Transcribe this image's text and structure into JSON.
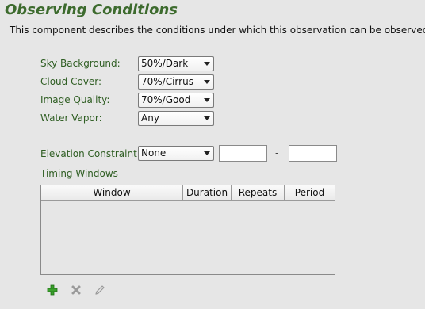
{
  "title": "Observing Conditions",
  "description": "This component describes the conditions under which this observation can be observed.",
  "conditions": {
    "sky_background": {
      "label": "Sky Background:",
      "value": "50%/Dark"
    },
    "cloud_cover": {
      "label": "Cloud Cover:",
      "value": "70%/Cirrus"
    },
    "image_quality": {
      "label": "Image Quality:",
      "value": "70%/Good"
    },
    "water_vapor": {
      "label": "Water Vapor:",
      "value": "Any"
    }
  },
  "elevation": {
    "label": "Elevation Constraint:",
    "value": "None",
    "min_value": "",
    "max_value": "",
    "separator": "-"
  },
  "timing_windows": {
    "label": "Timing Windows",
    "columns": [
      "Window",
      "Duration",
      "Repeats",
      "Period"
    ],
    "rows": []
  },
  "toolbar": {
    "add_icon": "plus-icon",
    "remove_icon": "x-icon",
    "edit_icon": "pencil-icon"
  },
  "colors": {
    "title": "#3d6b2e",
    "label": "#2f5e23",
    "add_green": "#3aa12c",
    "background": "#e6e6e6"
  }
}
